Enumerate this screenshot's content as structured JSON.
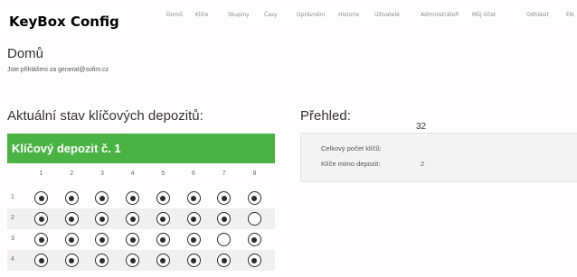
{
  "navbar": {
    "brand": "KeyBox Config",
    "items": [
      "Domů",
      "Klíče",
      "Skupiny",
      "Časy",
      "Oprávnění",
      "Historie",
      "Uživatelé",
      "Administrátoři",
      "Můj Účet"
    ],
    "logout": "Odhlásit",
    "lang": "EN"
  },
  "page": {
    "title": "Domů",
    "login_text": "Jste přihlášeni za general@sofim.cz"
  },
  "depots": {
    "section_title": "Aktuální stav klíčových depozitů:",
    "depot_title": "Klíčový depozit č. 1",
    "columns": [
      "1",
      "2",
      "3",
      "4",
      "5",
      "6",
      "7",
      "8"
    ],
    "rows": [
      {
        "label": "1",
        "slots": [
          true,
          true,
          true,
          true,
          true,
          true,
          true,
          true
        ]
      },
      {
        "label": "2",
        "slots": [
          true,
          true,
          true,
          true,
          true,
          true,
          true,
          false
        ]
      },
      {
        "label": "3",
        "slots": [
          true,
          true,
          true,
          true,
          true,
          true,
          false,
          true
        ]
      },
      {
        "label": "4",
        "slots": [
          true,
          true,
          true,
          true,
          true,
          true,
          true,
          true
        ]
      }
    ]
  },
  "overview": {
    "title": "Přehled:",
    "total_label": "Celkový počet klíčů:",
    "total_value": "32",
    "outside_label": "Klíče mimo depozit:",
    "outside_value": "2"
  },
  "colors": {
    "depot_header": "#4bb344",
    "slot_border": "#2b2b2b"
  }
}
